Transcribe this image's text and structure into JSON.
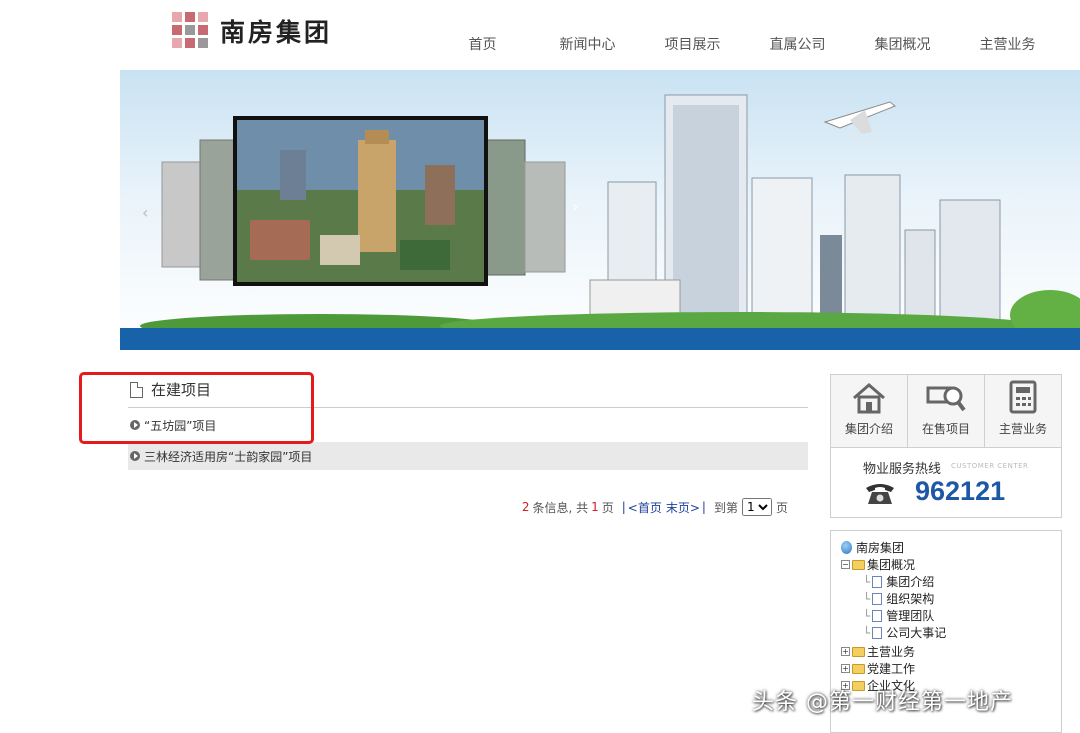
{
  "brand": {
    "name": "南房集团"
  },
  "nav": {
    "items": [
      {
        "label": "首页"
      },
      {
        "label": "新闻中心"
      },
      {
        "label": "项目展示"
      },
      {
        "label": "直属公司"
      },
      {
        "label": "集团概况"
      },
      {
        "label": "主营业务"
      }
    ]
  },
  "section": {
    "title": "在建项目",
    "items": [
      {
        "label": "“五坊园”项目"
      },
      {
        "label": "三林经济适用房“士韵家园”项目"
      }
    ]
  },
  "pager": {
    "total": "2",
    "info_mid": "条信息, 共",
    "pages": "1",
    "page_unit": "页",
    "first": "<首页",
    "last": "末页>",
    "goto": "到第",
    "page_value": "1",
    "suffix": "页"
  },
  "quick_links": [
    {
      "label": "集团介绍",
      "icon": "house-icon"
    },
    {
      "label": "在售项目",
      "icon": "magnifier-icon"
    },
    {
      "label": "主营业务",
      "icon": "calculator-icon"
    }
  ],
  "hotline": {
    "title": "物业服务热线",
    "en": "CUSTOMER CENTER",
    "number": "962121"
  },
  "tree": {
    "root": "南房集团",
    "group": "集团概况",
    "children": [
      "集团介绍",
      "组织架构",
      "管理团队",
      "公司大事记"
    ],
    "others": [
      "主营业务",
      "党建工作",
      "企业文化"
    ]
  },
  "watermark": "头条 @第一财经第一地产",
  "colors": {
    "accent": "#1762a8",
    "highlight": "#e31b1b",
    "hotline": "#1e57a6"
  }
}
